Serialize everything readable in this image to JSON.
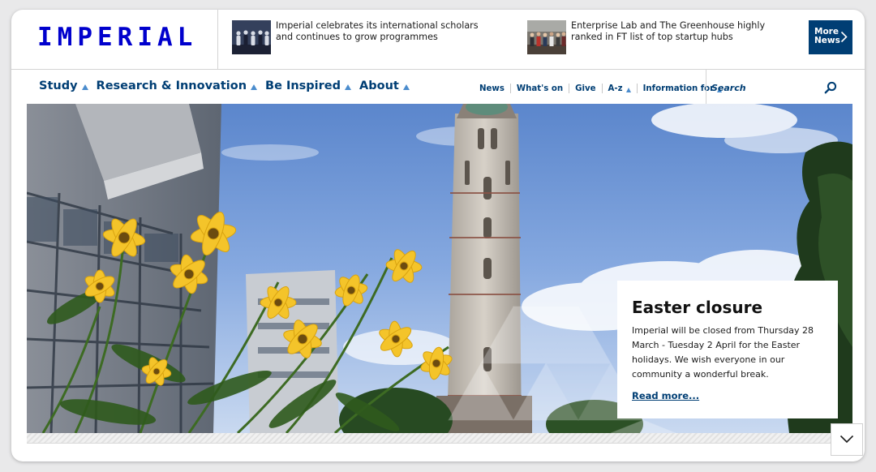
{
  "brand": {
    "logo_text": "IMPERIAL",
    "primary_color": "#003e74",
    "logo_color": "#0000cd",
    "accent_color": "#4b8ccd"
  },
  "news_ticker": {
    "items": [
      {
        "title": "Imperial celebrates its international scholars and continues to grow programmes"
      },
      {
        "title": "Enterprise Lab and The Greenhouse highly ranked in FT list of top startup hubs"
      }
    ],
    "more_label": "More News",
    "more_icon": "chevron-right-icon"
  },
  "main_nav": {
    "items": [
      {
        "label": "Study"
      },
      {
        "label": "Research & Innovation"
      },
      {
        "label": "Be Inspired"
      },
      {
        "label": "About"
      }
    ],
    "dropdown_icon": "triangle-up-icon"
  },
  "utility_nav": {
    "items": [
      {
        "label": "News",
        "has_dropdown": false
      },
      {
        "label": "What's on",
        "has_dropdown": false
      },
      {
        "label": "Give",
        "has_dropdown": false
      },
      {
        "label": "A-z",
        "has_dropdown": true
      },
      {
        "label": "Information for",
        "has_dropdown": true
      }
    ]
  },
  "search": {
    "placeholder": "Search",
    "value": "",
    "icon": "search-icon"
  },
  "hero": {
    "caption_title": "Easter closure",
    "caption_body": "Imperial will be closed from Thursday 28 March - Tuesday 2 April for the Easter holidays. We wish everyone in our community a wonderful break.",
    "caption_link": "Read more...",
    "scroll_icon": "chevron-down-icon"
  }
}
